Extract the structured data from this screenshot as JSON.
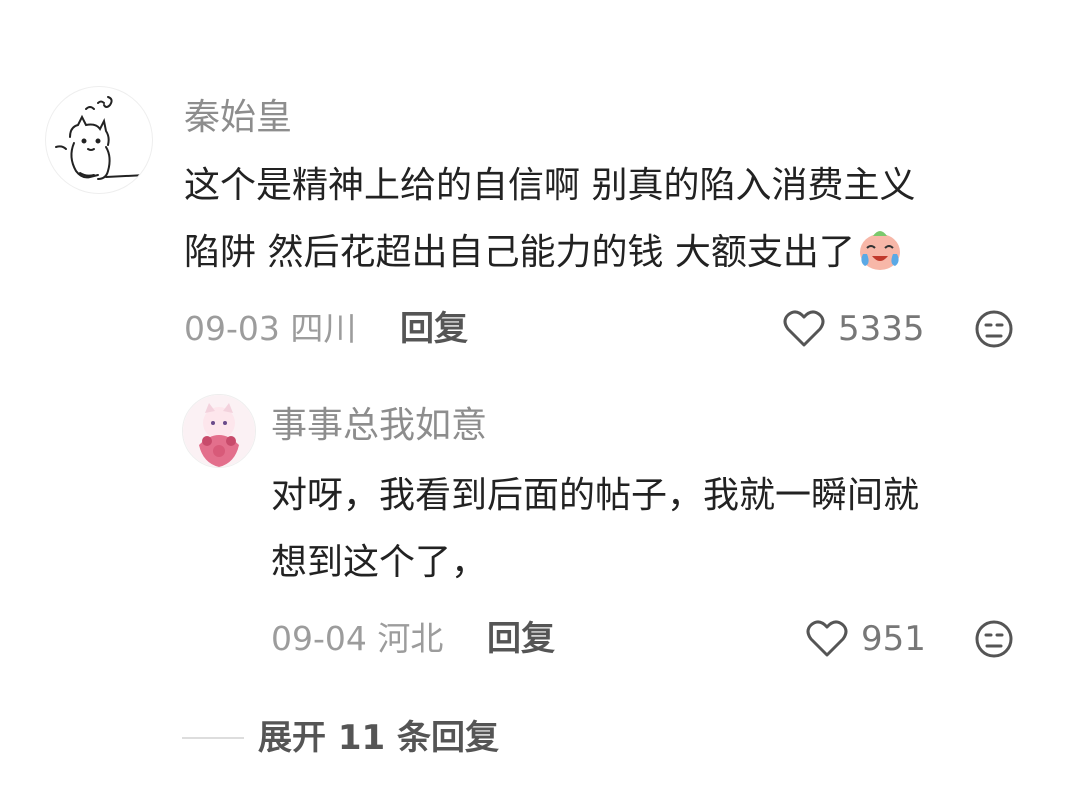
{
  "comment": {
    "username": "秦始皇",
    "text_line1": "这个是精神上给的自信啊 别真的陷入消费主义",
    "text_line2": "陷阱 然后花超出自己能力的钱 大额支出了",
    "emoji": "crying-laughing-emoji",
    "date": "09-03",
    "location": "四川",
    "reply_label": "回复",
    "likes": "5335"
  },
  "reply": {
    "username": "事事总我如意",
    "text_line1": "对呀，我看到后面的帖子，我就一瞬间就",
    "text_line2": "想到这个了，",
    "date": "09-04",
    "location": "河北",
    "reply_label": "回复",
    "likes": "951"
  },
  "expand": {
    "label": "展开 11 条回复"
  },
  "icons": {
    "like": "heart-outline-icon",
    "dislike": "frown-face-icon"
  }
}
